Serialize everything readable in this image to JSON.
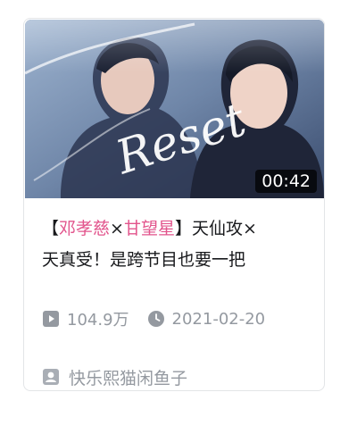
{
  "video": {
    "duration": "00:42",
    "thumbnail_text": "Reset",
    "title": {
      "open_bracket": "【",
      "name_1": "邓孝慈",
      "cross_1": "×",
      "name_2": "甘望星",
      "close_bracket": "】",
      "rest_line1": "天仙攻×",
      "rest_line2": "天真受！是跨节目也要一把"
    },
    "views": "104.9万",
    "date": "2021-02-20",
    "author": "快乐熙猫闲鱼子"
  },
  "colors": {
    "highlight": "#e2548c",
    "meta_gray": "#9499a0",
    "title_text": "#18191c"
  },
  "icons": {
    "views": "play-count-icon",
    "date": "clock-icon",
    "author": "up-user-icon"
  }
}
